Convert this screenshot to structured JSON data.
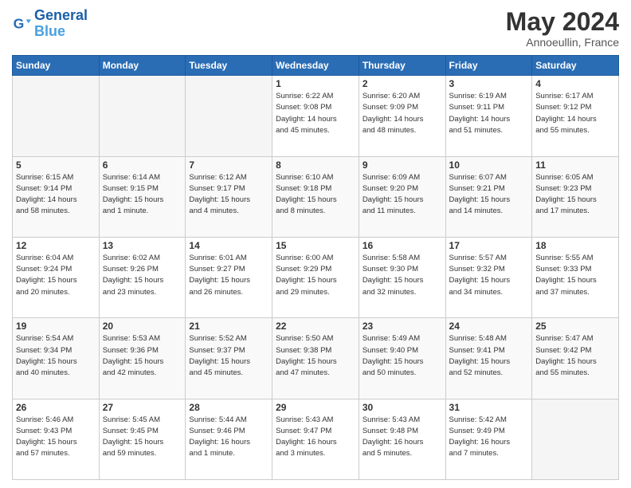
{
  "logo": {
    "line1": "General",
    "line2": "Blue"
  },
  "title": "May 2024",
  "location": "Annoeullin, France",
  "days_header": [
    "Sunday",
    "Monday",
    "Tuesday",
    "Wednesday",
    "Thursday",
    "Friday",
    "Saturday"
  ],
  "weeks": [
    {
      "days": [
        {
          "num": "",
          "info": []
        },
        {
          "num": "",
          "info": []
        },
        {
          "num": "",
          "info": []
        },
        {
          "num": "1",
          "info": [
            "Sunrise: 6:22 AM",
            "Sunset: 9:08 PM",
            "Daylight: 14 hours",
            "and 45 minutes."
          ]
        },
        {
          "num": "2",
          "info": [
            "Sunrise: 6:20 AM",
            "Sunset: 9:09 PM",
            "Daylight: 14 hours",
            "and 48 minutes."
          ]
        },
        {
          "num": "3",
          "info": [
            "Sunrise: 6:19 AM",
            "Sunset: 9:11 PM",
            "Daylight: 14 hours",
            "and 51 minutes."
          ]
        },
        {
          "num": "4",
          "info": [
            "Sunrise: 6:17 AM",
            "Sunset: 9:12 PM",
            "Daylight: 14 hours",
            "and 55 minutes."
          ]
        }
      ]
    },
    {
      "days": [
        {
          "num": "5",
          "info": [
            "Sunrise: 6:15 AM",
            "Sunset: 9:14 PM",
            "Daylight: 14 hours",
            "and 58 minutes."
          ]
        },
        {
          "num": "6",
          "info": [
            "Sunrise: 6:14 AM",
            "Sunset: 9:15 PM",
            "Daylight: 15 hours",
            "and 1 minute."
          ]
        },
        {
          "num": "7",
          "info": [
            "Sunrise: 6:12 AM",
            "Sunset: 9:17 PM",
            "Daylight: 15 hours",
            "and 4 minutes."
          ]
        },
        {
          "num": "8",
          "info": [
            "Sunrise: 6:10 AM",
            "Sunset: 9:18 PM",
            "Daylight: 15 hours",
            "and 8 minutes."
          ]
        },
        {
          "num": "9",
          "info": [
            "Sunrise: 6:09 AM",
            "Sunset: 9:20 PM",
            "Daylight: 15 hours",
            "and 11 minutes."
          ]
        },
        {
          "num": "10",
          "info": [
            "Sunrise: 6:07 AM",
            "Sunset: 9:21 PM",
            "Daylight: 15 hours",
            "and 14 minutes."
          ]
        },
        {
          "num": "11",
          "info": [
            "Sunrise: 6:05 AM",
            "Sunset: 9:23 PM",
            "Daylight: 15 hours",
            "and 17 minutes."
          ]
        }
      ]
    },
    {
      "days": [
        {
          "num": "12",
          "info": [
            "Sunrise: 6:04 AM",
            "Sunset: 9:24 PM",
            "Daylight: 15 hours",
            "and 20 minutes."
          ]
        },
        {
          "num": "13",
          "info": [
            "Sunrise: 6:02 AM",
            "Sunset: 9:26 PM",
            "Daylight: 15 hours",
            "and 23 minutes."
          ]
        },
        {
          "num": "14",
          "info": [
            "Sunrise: 6:01 AM",
            "Sunset: 9:27 PM",
            "Daylight: 15 hours",
            "and 26 minutes."
          ]
        },
        {
          "num": "15",
          "info": [
            "Sunrise: 6:00 AM",
            "Sunset: 9:29 PM",
            "Daylight: 15 hours",
            "and 29 minutes."
          ]
        },
        {
          "num": "16",
          "info": [
            "Sunrise: 5:58 AM",
            "Sunset: 9:30 PM",
            "Daylight: 15 hours",
            "and 32 minutes."
          ]
        },
        {
          "num": "17",
          "info": [
            "Sunrise: 5:57 AM",
            "Sunset: 9:32 PM",
            "Daylight: 15 hours",
            "and 34 minutes."
          ]
        },
        {
          "num": "18",
          "info": [
            "Sunrise: 5:55 AM",
            "Sunset: 9:33 PM",
            "Daylight: 15 hours",
            "and 37 minutes."
          ]
        }
      ]
    },
    {
      "days": [
        {
          "num": "19",
          "info": [
            "Sunrise: 5:54 AM",
            "Sunset: 9:34 PM",
            "Daylight: 15 hours",
            "and 40 minutes."
          ]
        },
        {
          "num": "20",
          "info": [
            "Sunrise: 5:53 AM",
            "Sunset: 9:36 PM",
            "Daylight: 15 hours",
            "and 42 minutes."
          ]
        },
        {
          "num": "21",
          "info": [
            "Sunrise: 5:52 AM",
            "Sunset: 9:37 PM",
            "Daylight: 15 hours",
            "and 45 minutes."
          ]
        },
        {
          "num": "22",
          "info": [
            "Sunrise: 5:50 AM",
            "Sunset: 9:38 PM",
            "Daylight: 15 hours",
            "and 47 minutes."
          ]
        },
        {
          "num": "23",
          "info": [
            "Sunrise: 5:49 AM",
            "Sunset: 9:40 PM",
            "Daylight: 15 hours",
            "and 50 minutes."
          ]
        },
        {
          "num": "24",
          "info": [
            "Sunrise: 5:48 AM",
            "Sunset: 9:41 PM",
            "Daylight: 15 hours",
            "and 52 minutes."
          ]
        },
        {
          "num": "25",
          "info": [
            "Sunrise: 5:47 AM",
            "Sunset: 9:42 PM",
            "Daylight: 15 hours",
            "and 55 minutes."
          ]
        }
      ]
    },
    {
      "days": [
        {
          "num": "26",
          "info": [
            "Sunrise: 5:46 AM",
            "Sunset: 9:43 PM",
            "Daylight: 15 hours",
            "and 57 minutes."
          ]
        },
        {
          "num": "27",
          "info": [
            "Sunrise: 5:45 AM",
            "Sunset: 9:45 PM",
            "Daylight: 15 hours",
            "and 59 minutes."
          ]
        },
        {
          "num": "28",
          "info": [
            "Sunrise: 5:44 AM",
            "Sunset: 9:46 PM",
            "Daylight: 16 hours",
            "and 1 minute."
          ]
        },
        {
          "num": "29",
          "info": [
            "Sunrise: 5:43 AM",
            "Sunset: 9:47 PM",
            "Daylight: 16 hours",
            "and 3 minutes."
          ]
        },
        {
          "num": "30",
          "info": [
            "Sunrise: 5:43 AM",
            "Sunset: 9:48 PM",
            "Daylight: 16 hours",
            "and 5 minutes."
          ]
        },
        {
          "num": "31",
          "info": [
            "Sunrise: 5:42 AM",
            "Sunset: 9:49 PM",
            "Daylight: 16 hours",
            "and 7 minutes."
          ]
        },
        {
          "num": "",
          "info": []
        }
      ]
    }
  ]
}
